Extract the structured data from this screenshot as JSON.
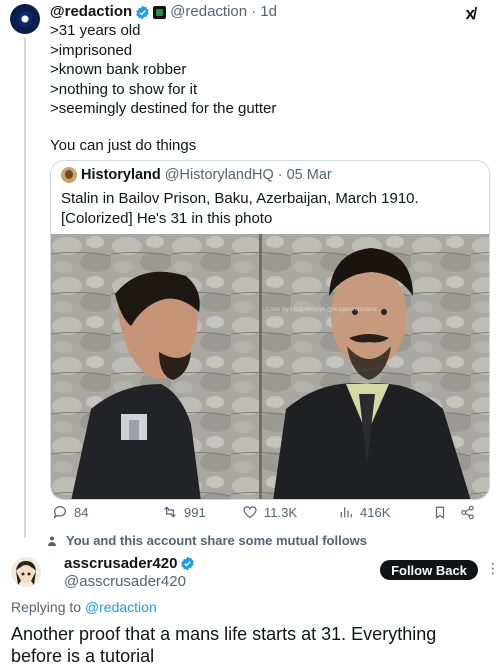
{
  "main_tweet": {
    "display_name": "@redaction",
    "handle": "@redaction",
    "time": "· 1d",
    "lines": [
      ">31 years old",
      ">imprisoned",
      ">known bank robber",
      ">nothing to show for it",
      ">seemingly destined for the gutter"
    ],
    "extra": "You can just do things",
    "grok_label": "x̸",
    "avatar_icon": "avatar-icon"
  },
  "quoted_tweet": {
    "display_name": "Historyland",
    "handle": "@HistorylandHQ",
    "time": "· 05 Mar",
    "text": "Stalin in Bailov Prison, Baku, Azerbaijan, March 1910. [Colorized] He's 31 in this photo",
    "watermark": "Color by Tural Huseyn @tiraglarimpistanx"
  },
  "actions": {
    "replies": "84",
    "reposts": "991",
    "likes": "11.3K",
    "views": "416K"
  },
  "mutual_follows": "You and this account share some mutual follows",
  "reply": {
    "display_name": "asscrusader420",
    "handle": "@asscrusader420",
    "follow_button": "Follow Back",
    "more": "⋮",
    "replying_prefix": "Replying to ",
    "replying_to": "@redaction",
    "text": "Another proof that a mans life starts at 31. Everything before is a tutorial"
  },
  "colors": {
    "verified": "#1d9bf0",
    "link": "#1d9bf0",
    "text": "#0f1419",
    "muted": "#536471",
    "border": "#cfd9de"
  }
}
